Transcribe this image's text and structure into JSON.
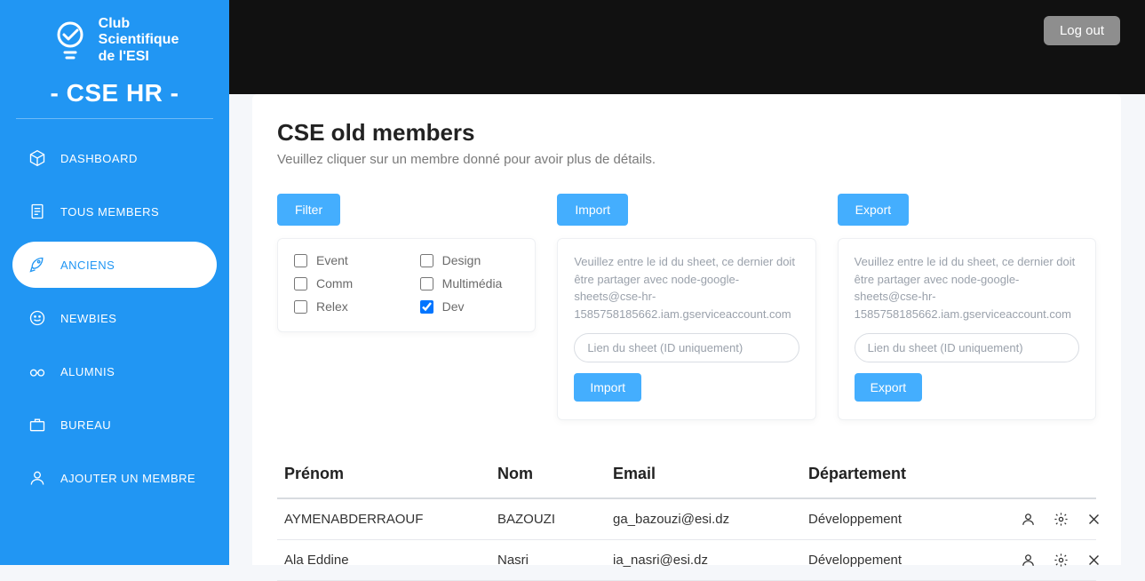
{
  "brand": {
    "line1": "Club",
    "line2": "Scientifique",
    "line3": "de l'ESI",
    "app_title": "- CSE HR -"
  },
  "topbar": {
    "logout": "Log out"
  },
  "sidebar": {
    "items": [
      {
        "label": "DASHBOARD"
      },
      {
        "label": "TOUS MEMBERS"
      },
      {
        "label": "ANCIENS"
      },
      {
        "label": "NEWBIES"
      },
      {
        "label": "ALUMNIS"
      },
      {
        "label": "BUREAU"
      },
      {
        "label": "AJOUTER UN MEMBRE"
      }
    ],
    "active_index": 2
  },
  "page": {
    "title": "CSE old members",
    "subtitle": "Veuillez cliquer sur un membre donné pour avoir plus de détails."
  },
  "filter": {
    "button": "Filter",
    "options": [
      {
        "label": "Event",
        "checked": false
      },
      {
        "label": "Design",
        "checked": false
      },
      {
        "label": "Comm",
        "checked": false
      },
      {
        "label": "Multimédia",
        "checked": false
      },
      {
        "label": "Relex",
        "checked": false
      },
      {
        "label": "Dev",
        "checked": true
      }
    ]
  },
  "import": {
    "button": "Import",
    "help": "Veuillez entre le id du sheet, ce dernier doit être partager avec node-google-sheets@cse-hr-1585758185662.iam.gserviceaccount.com",
    "placeholder": "Lien du sheet (ID uniquement)",
    "action": "Import"
  },
  "export": {
    "button": "Export",
    "help": "Veuillez entre le id du sheet, ce dernier doit être partager avec node-google-sheets@cse-hr-1585758185662.iam.gserviceaccount.com",
    "placeholder": "Lien du sheet (ID uniquement)",
    "action": "Export"
  },
  "table": {
    "columns": [
      "Prénom",
      "Nom",
      "Email",
      "Département"
    ],
    "rows": [
      {
        "prenom": "AYMENABDERRAOUF",
        "nom": "BAZOUZI",
        "email": "ga_bazouzi@esi.dz",
        "dept": "Développement"
      },
      {
        "prenom": "Ala Eddine",
        "nom": "Nasri",
        "email": "ia_nasri@esi.dz",
        "dept": "Développement"
      }
    ]
  }
}
